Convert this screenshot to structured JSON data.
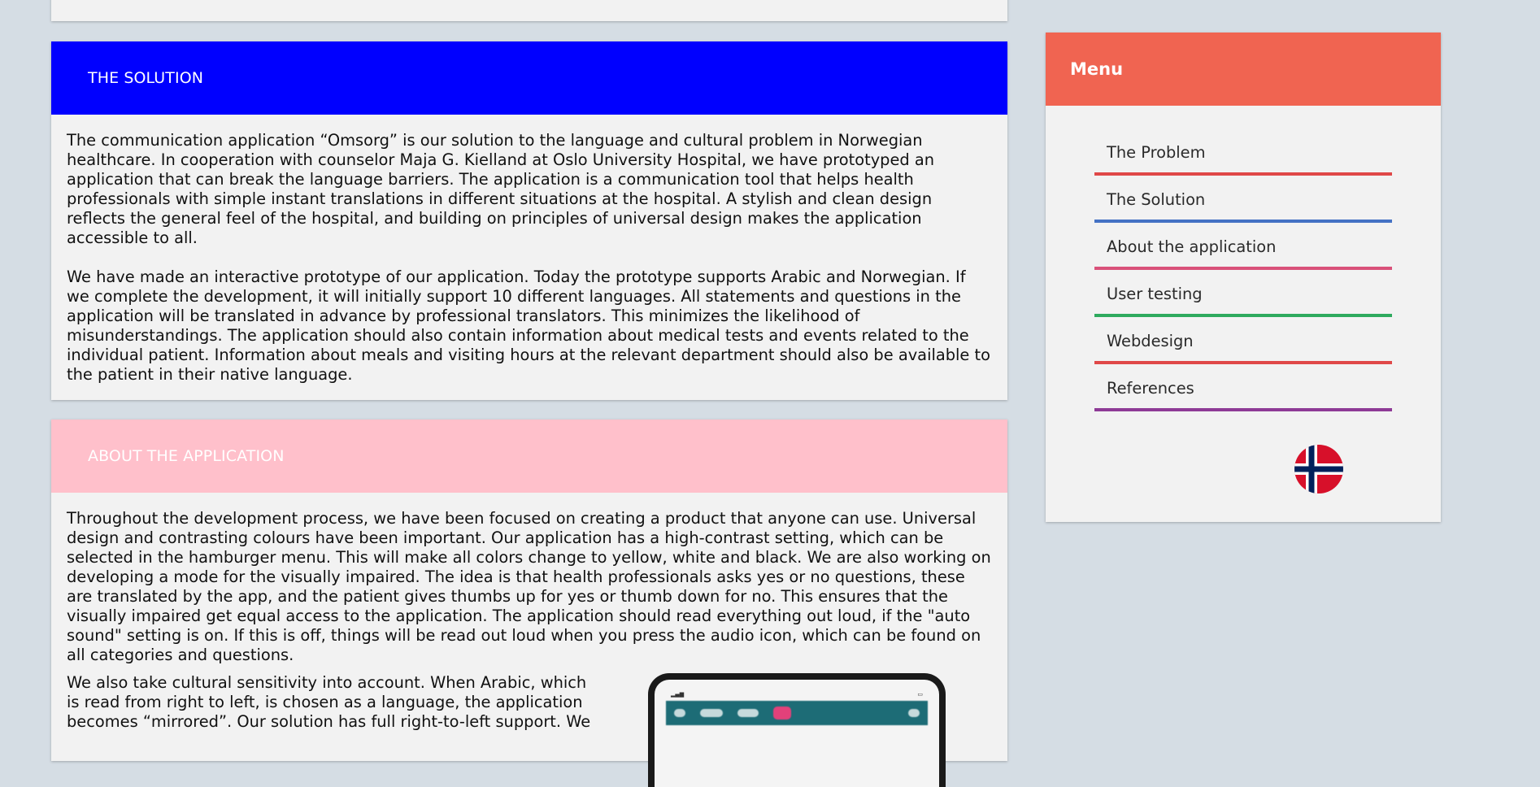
{
  "colors": {
    "page_background": "#d5dde4",
    "card_background": "#f2f2f2",
    "solution_header": "#0000ff",
    "about_header": "#ffc0cb",
    "menu_header": "#f06451"
  },
  "sections": {
    "solution": {
      "title": "THE SOLUTION",
      "paragraphs": [
        "The communication application “Omsorg” is our solution to the language and cultural problem in Norwegian healthcare. In cooperation with counselor Maja G. Kielland at Oslo University Hospital, we have prototyped an application that can break the language barriers. The application is a communication tool that helps health professionals with simple instant translations in different situations at the hospital. A stylish and clean design reflects the general feel of the hospital, and building on principles of universal design makes the application accessible to all.",
        "We have made an interactive prototype of our application. Today the prototype supports Arabic and Norwegian. If we complete the development, it will initially support 10 different languages. All statements and questions in the application will be translated in advance by professional translators. This minimizes the likelihood of misunderstandings. The application should also contain information about medical tests and events related to the individual patient. Information about meals and visiting hours at the relevant department should also be available to the patient in their native language."
      ]
    },
    "about": {
      "title": "ABOUT THE APPLICATION",
      "paragraphs": [
        "Throughout the development process, we have been focused on creating a product that anyone can use. Universal design and contrasting colours have been important. Our application has a high-contrast setting, which can be selected in the hamburger menu. This will make all colors change to yellow, white and black. We are also working on developing a mode for the visually impaired. The idea is that health professionals asks yes or no questions, these are translated by the app, and the patient gives thumbs up for yes or thumb down for no. This ensures that the visually impaired get equal access to the application. The application should read everything out loud, if the \"auto sound\" setting is on. If this is off, things will be read out loud when you press the audio icon, which can be found on all categories and questions.",
        "We also take cultural sensitivity into account. When Arabic, which is read from right to left, is chosen as a language, the application becomes “mirrored”. Our solution has full right-to-left support. We"
      ]
    }
  },
  "menu": {
    "title": "Menu",
    "items": [
      {
        "label": "The Problem",
        "color": "#e04848"
      },
      {
        "label": "The Solution",
        "color": "#4472c4"
      },
      {
        "label": "About the application",
        "color": "#d9517a"
      },
      {
        "label": "User testing",
        "color": "#2eaa5e"
      },
      {
        "label": "Webdesign",
        "color": "#e04848"
      },
      {
        "label": "References",
        "color": "#8e3a96"
      }
    ],
    "flag_icon": "norwegian-flag-icon"
  }
}
